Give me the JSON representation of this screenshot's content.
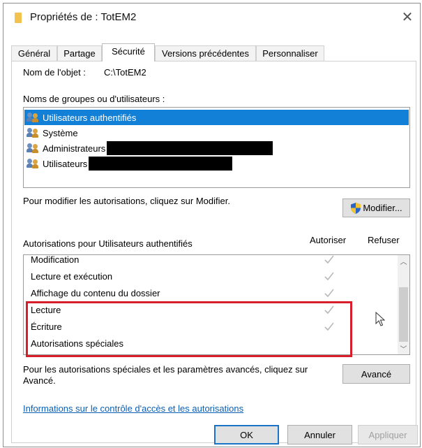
{
  "window": {
    "title": "Propriétés de : TotEM2"
  },
  "tabs": [
    {
      "label": "Général"
    },
    {
      "label": "Partage"
    },
    {
      "label": "Sécurité"
    },
    {
      "label": "Versions précédentes"
    },
    {
      "label": "Personnaliser"
    }
  ],
  "object": {
    "label": "Nom de l'objet :",
    "value": "C:\\TotEM2"
  },
  "groups": {
    "label": "Noms de groupes ou d'utilisateurs :",
    "items": [
      {
        "name": "Utilisateurs authentifiés",
        "selected": true
      },
      {
        "name": "Système"
      },
      {
        "name": "Administrateurs"
      },
      {
        "name": "Utilisateurs"
      }
    ]
  },
  "modify": {
    "hint": "Pour modifier les autorisations, cliquez sur Modifier.",
    "button": "Modifier..."
  },
  "permissions": {
    "label": "Autorisations pour Utilisateurs authentifiés",
    "allow_header": "Autoriser",
    "deny_header": "Refuser",
    "rows": [
      {
        "name": "Modification"
      },
      {
        "name": "Lecture et exécution"
      },
      {
        "name": "Affichage du contenu du dossier"
      },
      {
        "name": "Lecture"
      },
      {
        "name": "Écriture"
      },
      {
        "name": "Autorisations spéciales"
      }
    ]
  },
  "advanced": {
    "hint": "Pour les autorisations spéciales et les paramètres avancés, cliquez sur Avancé.",
    "button": "Avancé"
  },
  "link": "Informations sur le contrôle d'accès et les autorisations",
  "footer": {
    "ok": "OK",
    "cancel": "Annuler",
    "apply": "Appliquer"
  },
  "colors": {
    "selection": "#1380d8",
    "highlight": "#d61f2b",
    "link": "#0a5fb4"
  }
}
